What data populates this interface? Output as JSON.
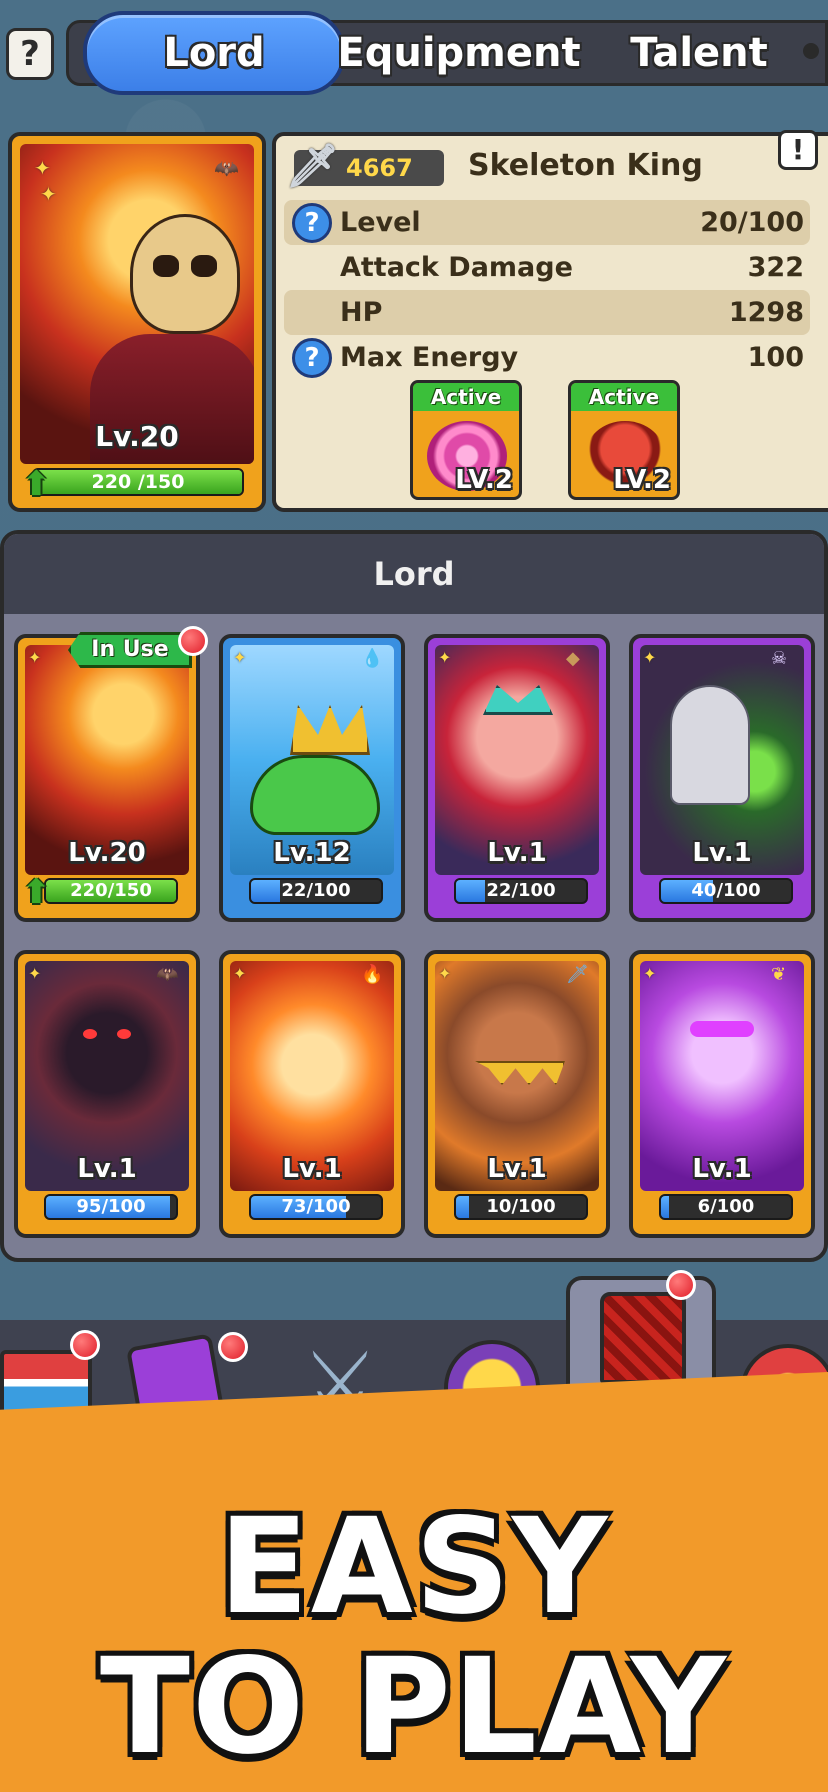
{
  "tabs": {
    "help": "?",
    "lord": "Lord",
    "equipment": "Equipment",
    "talent": "Talent"
  },
  "hero": {
    "power": "4667",
    "name": "Skeleton King",
    "level_label": "Lv.20",
    "xp": "220 /150",
    "xp_progress": 1.0,
    "alert": "!",
    "stats": [
      {
        "label": "Level",
        "value": "20/100"
      },
      {
        "label": "Attack Damage",
        "value": "322"
      },
      {
        "label": "HP",
        "value": "1298"
      },
      {
        "label": "Max Energy",
        "value": "100"
      }
    ],
    "skills": [
      {
        "tag": "Active",
        "level": "LV.2"
      },
      {
        "tag": "Active",
        "level": "LV.2"
      }
    ]
  },
  "lord_section": {
    "title": "Lord",
    "in_use": "In Use",
    "cards": [
      {
        "level": "Lv.20",
        "progress": "220/150",
        "fill": 1.0
      },
      {
        "level": "Lv.12",
        "progress": "22/100",
        "fill": 0.22
      },
      {
        "level": "Lv.1",
        "progress": "22/100",
        "fill": 0.22
      },
      {
        "level": "Lv.1",
        "progress": "40/100",
        "fill": 0.4
      },
      {
        "level": "Lv.1",
        "progress": "95/100",
        "fill": 0.95
      },
      {
        "level": "Lv.1",
        "progress": "73/100",
        "fill": 0.73
      },
      {
        "level": "Lv.1",
        "progress": "10/100",
        "fill": 0.1
      },
      {
        "level": "Lv.1",
        "progress": "6/100",
        "fill": 0.06
      }
    ]
  },
  "banner": {
    "line1": "EASY",
    "line2": "TO PLAY"
  },
  "colors": {
    "accent_blue": "#3c7fe8",
    "gold": "#f0a21c",
    "purple": "#9b3fd8",
    "banner_orange": "#f29a2a"
  }
}
